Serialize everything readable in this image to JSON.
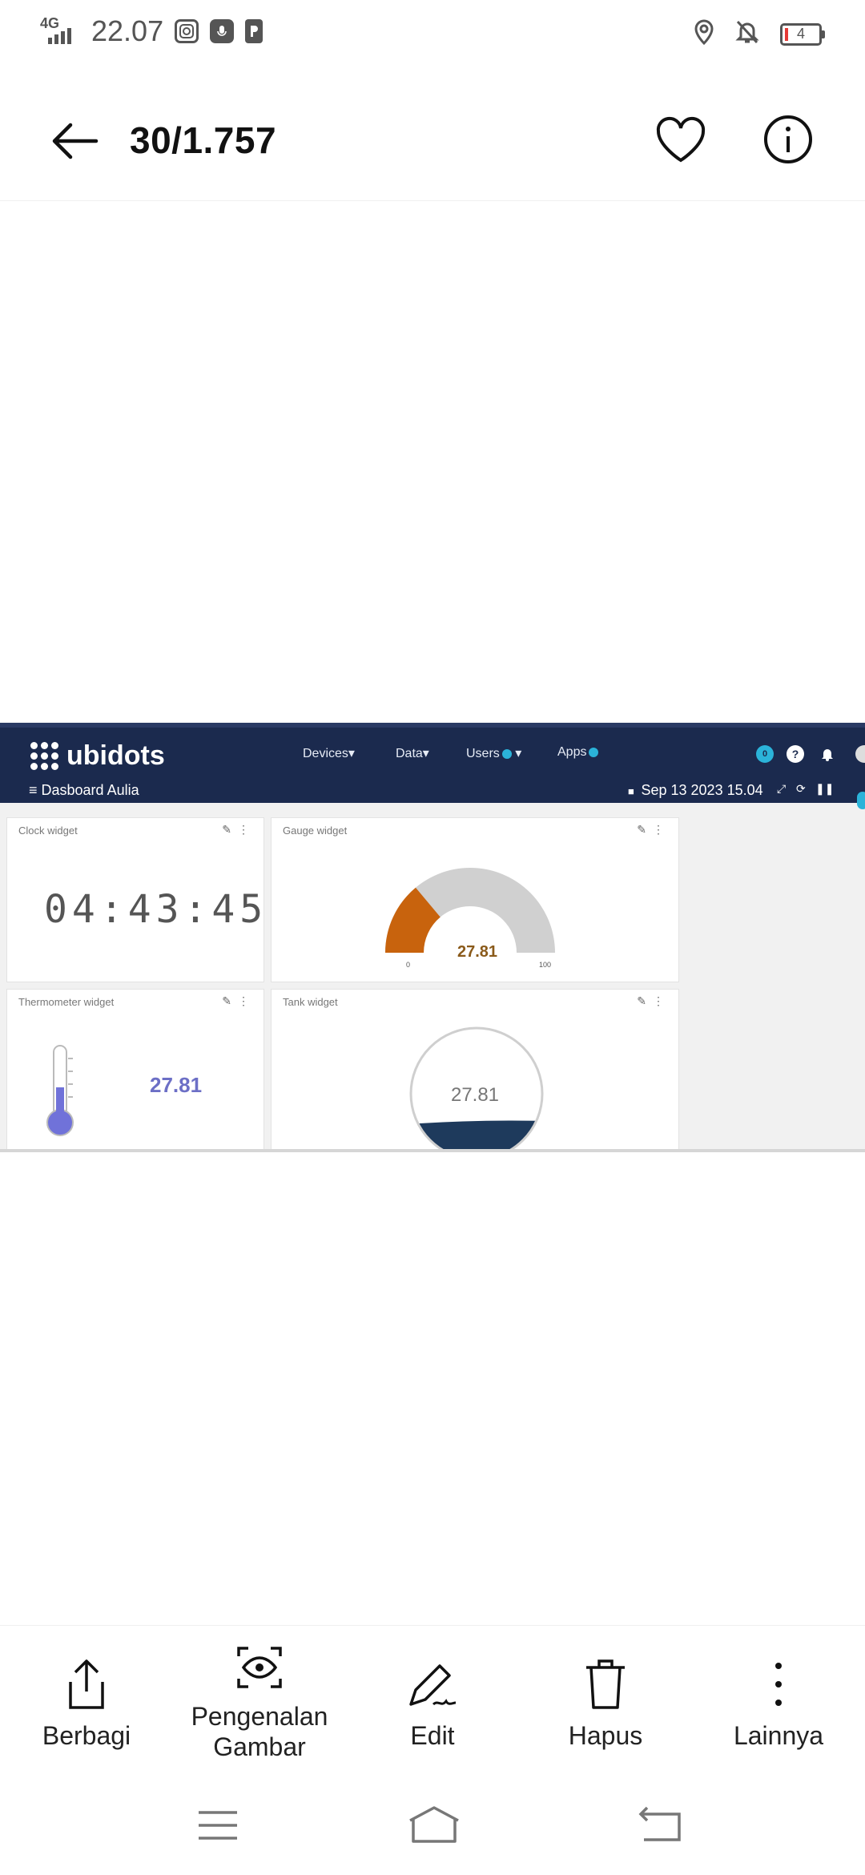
{
  "status_bar": {
    "network": "4G",
    "time": "22.07",
    "battery_level": "4",
    "app_icons": [
      "instagram-icon",
      "voice-recorder-icon",
      "parking-app-icon"
    ],
    "right_icons": [
      "location-icon",
      "notifications-off-icon",
      "battery-icon"
    ]
  },
  "app_bar": {
    "counter": "30/1.757",
    "back_icon": "arrow-left-icon",
    "favorite_icon": "heart-outline-icon",
    "info_icon": "info-circle-icon"
  },
  "screenshot": {
    "brand": "ubidots",
    "menu": {
      "devices": "Devices",
      "data": "Data",
      "users": "Users",
      "apps": "Apps"
    },
    "notification_count": "0",
    "help_glyph": "?",
    "dashboard_name": "Dasboard Aulia",
    "date": "Sep 13 2023 15.04",
    "widgets": {
      "clock": {
        "title": "Clock widget",
        "value": "04:43:45"
      },
      "gauge": {
        "title": "Gauge widget",
        "value": "27.81",
        "min": "0",
        "max": "100",
        "fraction": 0.2781
      },
      "thermometer": {
        "title": "Thermometer widget",
        "value": "27.81"
      },
      "tank": {
        "title": "Tank widget",
        "value": "27.81"
      }
    },
    "colors": {
      "nav_bg": "#1b2a4e",
      "gauge_fill": "#c8630d",
      "gauge_track": "#d0d0d0",
      "thermo_fill": "#7072d9",
      "tank_fill": "#1e3a5c",
      "accent_dot": "#2bb3d9"
    }
  },
  "actions": {
    "share": "Berbagi",
    "recognize": "Pengenalan Gambar",
    "edit": "Edit",
    "delete": "Hapus",
    "more": "Lainnya"
  }
}
